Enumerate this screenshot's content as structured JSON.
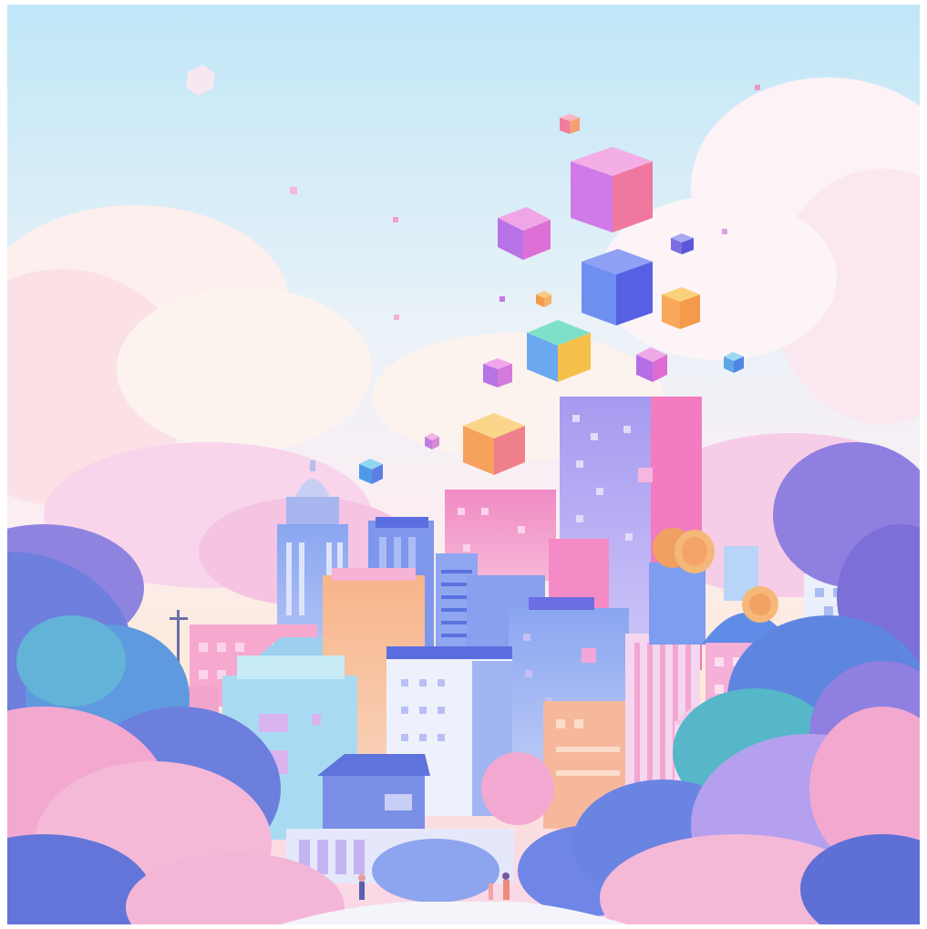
{
  "scene": {
    "subject": "isometric-city-illustration",
    "palette": {
      "sky_top": "#bfe6f7",
      "sky_mid": "#f6eef6",
      "sky_bottom": "#fde9d6",
      "cloud_pink": "#f6c6e2",
      "cloud_white": "#fdf4f7",
      "bush_purple": "#8f7fe0",
      "bush_blue": "#5d8fe0",
      "bush_pink": "#f3a9d3",
      "cube_purple": "#c86ee8",
      "cube_blue": "#6a7ff0",
      "cube_orange": "#f7a85a",
      "coin_gold": "#f4b36e"
    }
  }
}
